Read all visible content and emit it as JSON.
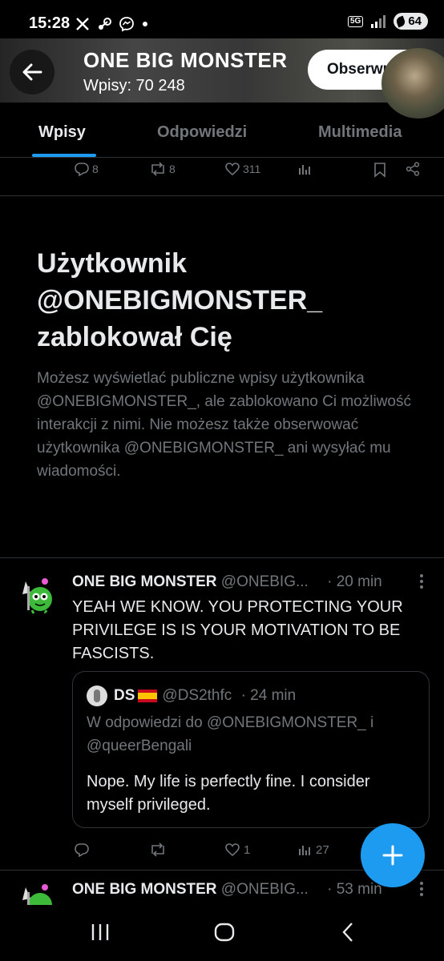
{
  "status_bar": {
    "time": "15:28",
    "notif_icons": [
      "x-icon",
      "steam-icon",
      "messenger-icon",
      "dot-icon"
    ],
    "network": "5G",
    "battery": "64"
  },
  "header": {
    "title": "ONE BIG MONSTER",
    "posts_count": "Wpisy: 70 248",
    "follow_label": "Obserwuj"
  },
  "tabs": [
    {
      "label": "Wpisy",
      "active": true
    },
    {
      "label": "Odpowiedzi",
      "active": false
    },
    {
      "label": "Multimedia",
      "active": false
    }
  ],
  "prev_tweet_actions": {
    "replies": "8",
    "reposts": "8",
    "likes": "311"
  },
  "blocked": {
    "title_line1": "Użytkownik",
    "title_line2": "@ONEBIGMONSTER_",
    "title_line3": "zablokował Cię",
    "description": "Możesz wyświetlać publiczne wpisy użytkownika @ONEBIGMONSTER_, ale zablokowano Ci możliwość interakcji z nimi. Nie możesz także obserwować użytkownika @ONEBIGMONSTER_ ani wysyłać mu wiadomości."
  },
  "tweet": {
    "name": "ONE BIG MONSTER",
    "handle": "@ONEBIG...",
    "time": "· 20 min",
    "text": "YEAH WE KNOW. YOU PROTECTING YOUR PRIVILEGE IS IS YOUR MOTIVATION TO BE FASCISTS.",
    "quote": {
      "name": "DS",
      "handle": "@DS2thfc",
      "time": "· 24 min",
      "reply_to": "W odpowiedzi do @ONEBIGMONSTER_ i @queerBengali",
      "text": "Nope. My life is perfectly fine. I consider myself privileged."
    },
    "actions": {
      "replies": "",
      "reposts": "",
      "likes": "1",
      "views": "27"
    }
  },
  "tweet2": {
    "name": "ONE BIG MONSTER",
    "handle": "@ONEBIG...",
    "time": "· 53 min"
  },
  "colors": {
    "accent": "#1d9bf0",
    "muted": "#71767b",
    "divider": "#2f3336",
    "avatar_green": "#3dba3a"
  }
}
